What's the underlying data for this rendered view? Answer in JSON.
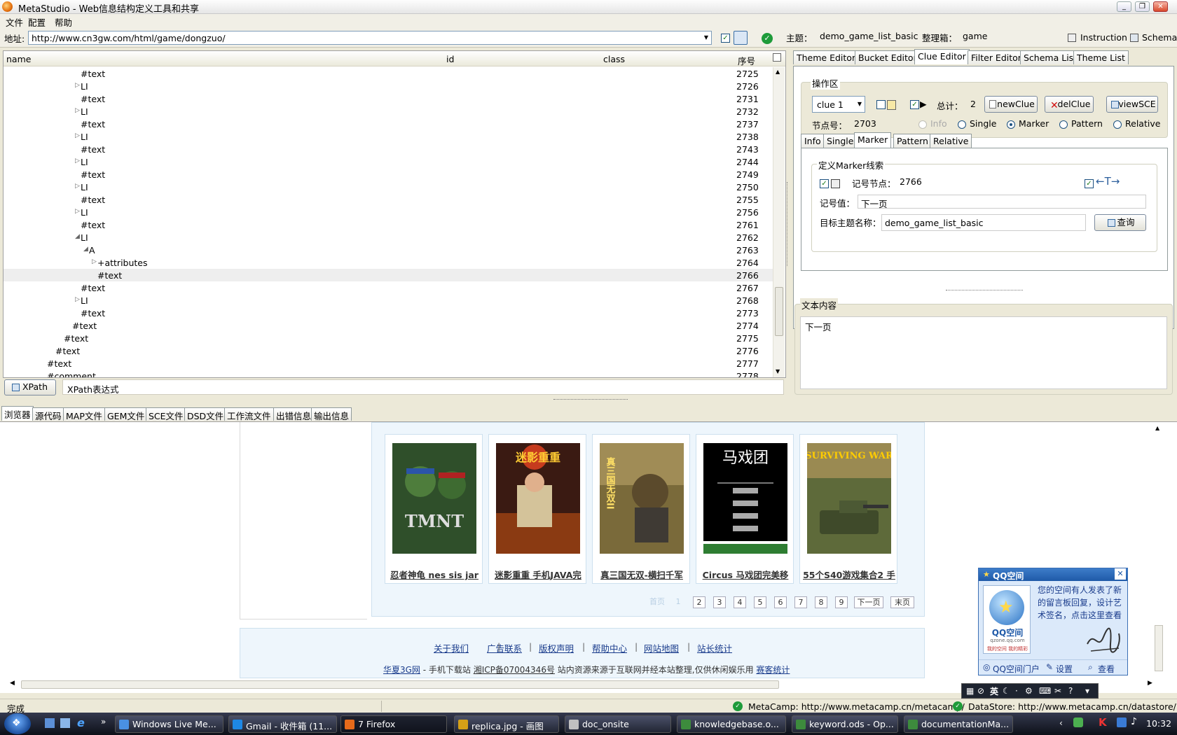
{
  "window": {
    "title": "MetaStudio - Web信息结构定义工具和共享"
  },
  "menu": [
    "文件",
    "配置",
    "帮助"
  ],
  "address": {
    "label": "地址:",
    "url": "http://www.cn3gw.com/html/game/dongzuo/",
    "theme_label": "主题：",
    "theme_value": "demo_game_list_basic",
    "box_label": "整理箱：",
    "box_value": "game",
    "instruction": "Instruction",
    "schema": "Schema"
  },
  "tree": {
    "columns": [
      "name",
      "id",
      "class",
      "序号"
    ],
    "rows": [
      {
        "name": "#text",
        "seq": "2725",
        "indent": 0,
        "toggle": ""
      },
      {
        "name": "LI",
        "seq": "2726",
        "indent": 0,
        "toggle": "closed"
      },
      {
        "name": "#text",
        "seq": "2731",
        "indent": 0,
        "toggle": ""
      },
      {
        "name": "LI",
        "seq": "2732",
        "indent": 0,
        "toggle": "closed"
      },
      {
        "name": "#text",
        "seq": "2737",
        "indent": 0,
        "toggle": ""
      },
      {
        "name": "LI",
        "seq": "2738",
        "indent": 0,
        "toggle": "closed"
      },
      {
        "name": "#text",
        "seq": "2743",
        "indent": 0,
        "toggle": ""
      },
      {
        "name": "LI",
        "seq": "2744",
        "indent": 0,
        "toggle": "closed"
      },
      {
        "name": "#text",
        "seq": "2749",
        "indent": 0,
        "toggle": ""
      },
      {
        "name": "LI",
        "seq": "2750",
        "indent": 0,
        "toggle": "closed"
      },
      {
        "name": "#text",
        "seq": "2755",
        "indent": 0,
        "toggle": ""
      },
      {
        "name": "LI",
        "seq": "2756",
        "indent": 0,
        "toggle": "closed"
      },
      {
        "name": "#text",
        "seq": "2761",
        "indent": 0,
        "toggle": ""
      },
      {
        "name": "LI",
        "seq": "2762",
        "indent": 0,
        "toggle": "open"
      },
      {
        "name": "A",
        "seq": "2763",
        "indent": 1,
        "toggle": "open"
      },
      {
        "name": "+attributes",
        "seq": "2764",
        "indent": 2,
        "toggle": "closed"
      },
      {
        "name": "#text",
        "seq": "2766",
        "indent": 2,
        "toggle": "",
        "selected": true
      },
      {
        "name": "#text",
        "seq": "2767",
        "indent": 0,
        "toggle": ""
      },
      {
        "name": "LI",
        "seq": "2768",
        "indent": 0,
        "toggle": "closed"
      },
      {
        "name": "#text",
        "seq": "2773",
        "indent": 0,
        "toggle": ""
      },
      {
        "name": "#text",
        "seq": "2774",
        "indent": -1,
        "toggle": ""
      },
      {
        "name": "#text",
        "seq": "2775",
        "indent": -2,
        "toggle": ""
      },
      {
        "name": "#text",
        "seq": "2776",
        "indent": -3,
        "toggle": ""
      },
      {
        "name": "#text",
        "seq": "2777",
        "indent": -4,
        "toggle": ""
      },
      {
        "name": "#comment",
        "seq": "2778",
        "indent": -4,
        "toggle": ""
      }
    ]
  },
  "xpath": {
    "button": "XPath",
    "placeholder": "XPath表达式"
  },
  "right": {
    "tabs": [
      "Theme Editor",
      "Bucket Editor",
      "Clue Editor",
      "Filter Editor",
      "Schema List",
      "Theme List"
    ],
    "ops_label": "操作区",
    "clue_select": "clue 1",
    "total_label": "总计：",
    "total_value": "2",
    "new_clue": "newClue",
    "del_clue": "delClue",
    "view_sce": "viewSCE",
    "node_label": "节点号：",
    "node_value": "2703",
    "modes": [
      "Info",
      "Single",
      "Marker",
      "Pattern",
      "Relative"
    ],
    "subtabs": [
      "Info",
      "Single",
      "Marker",
      "Pattern",
      "Relative"
    ],
    "marker_group": "定义Marker线索",
    "marker_node_label": "记号节点：",
    "marker_node_value": "2766",
    "marker_value_label": "记号值：",
    "marker_value": "下一页",
    "target_label": "目标主题名称：",
    "target_value": "demo_game_list_basic",
    "query": "查询",
    "text_label": "文本内容",
    "text_value": "下一页"
  },
  "bottom_tabs": [
    "浏览器",
    "源代码",
    "MAP文件",
    "GEM文件",
    "SCE文件",
    "DSD文件",
    "工作流文件",
    "出错信息",
    "输出信息"
  ],
  "games": [
    {
      "title": "忍者神龟 nes sis jar",
      "art": "TMNT"
    },
    {
      "title": "迷影重重 手机JAVA完",
      "art": "迷影重重"
    },
    {
      "title": "真三国无双-横扫千军",
      "art": "真三国无双II"
    },
    {
      "title": "Circus 马戏团完美移",
      "art": "马戏团"
    },
    {
      "title": "55个S40游戏集合2 手",
      "art": "SURVIVING WAR"
    }
  ],
  "pager": {
    "first": "首页",
    "current": "1",
    "pages": [
      "2",
      "3",
      "4",
      "5",
      "6",
      "7",
      "8",
      "9"
    ],
    "next": "下一页",
    "last": "末页"
  },
  "footer": {
    "links": [
      "关于我们",
      "广告联系",
      "版权声明",
      "帮助中心",
      "网站地图",
      "站长统计"
    ],
    "line2_a": "华夏3G网",
    "line2_b": " - 手机下载站 ",
    "line2_c": "湘ICP备07004346号",
    "line2_d": " 站内资源来源于互联网并经本站整理,仅供休闲娱乐用 ",
    "line2_e": "赛客统计"
  },
  "qq": {
    "title": "QQ空间",
    "message": "您的空间有人发表了新的留言板回复，设计艺术签名，点击这里查看",
    "logo": "QQ空间",
    "logo_sub": "qzone.qq.com",
    "logo_tag": "我的空间 我的精彩",
    "links": [
      "QQ空间门户",
      "设置",
      "查看"
    ]
  },
  "status": {
    "text": "完成",
    "metacamp": "MetaCamp: http://www.metacamp.cn/metacamp/",
    "datastore": "DataStore: http://www.metacamp.cn/datastore/"
  },
  "taskbar": {
    "items": [
      "Windows Live Me...",
      "Gmail - 收件箱 (11...",
      "7 Firefox",
      "replica.jpg - 画图",
      "doc_onsite",
      "knowledgebase.o...",
      "keyword.ods - Op...",
      "documentationMa..."
    ],
    "tray_lang": "英",
    "clock": "10:32"
  }
}
